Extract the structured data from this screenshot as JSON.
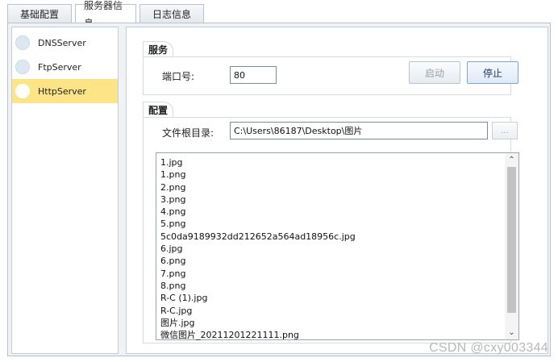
{
  "tabs": [
    {
      "label": "基础配置",
      "active": false
    },
    {
      "label": "服务器信息",
      "active": true
    },
    {
      "label": "日志信息",
      "active": false
    }
  ],
  "servers": [
    {
      "label": "DNSServer",
      "selected": false
    },
    {
      "label": "FtpServer",
      "selected": false
    },
    {
      "label": "HttpServer",
      "selected": true
    }
  ],
  "service": {
    "title": "服务",
    "port_label": "端口号:",
    "port_value": "80",
    "start_label": "启动",
    "stop_label": "停止"
  },
  "config": {
    "title": "配置",
    "root_label": "文件根目录:",
    "root_value": "C:\\Users\\86187\\Desktop\\图片",
    "browse_label": "..."
  },
  "files": [
    "1.jpg",
    "1.png",
    "2.png",
    "3.png",
    "4.png",
    "5.png",
    "5c0da9189932dd212652a564ad18956c.jpg",
    "6.jpg",
    "6.png",
    "7.png",
    "8.png",
    "R-C (1).jpg",
    "R-C.jpg",
    "图片.jpg",
    "微信图片_20211201221111.png"
  ],
  "scroll_position": 0.0,
  "icons": {
    "scroll_up": "chevron-up-icon",
    "scroll_down": "chevron-down-icon",
    "server_item": "circle-icon"
  },
  "colors": {
    "selected_bg": "#fde487",
    "panel_bg": "#f0f3f6"
  },
  "watermark": "CSDN @cxy003344"
}
